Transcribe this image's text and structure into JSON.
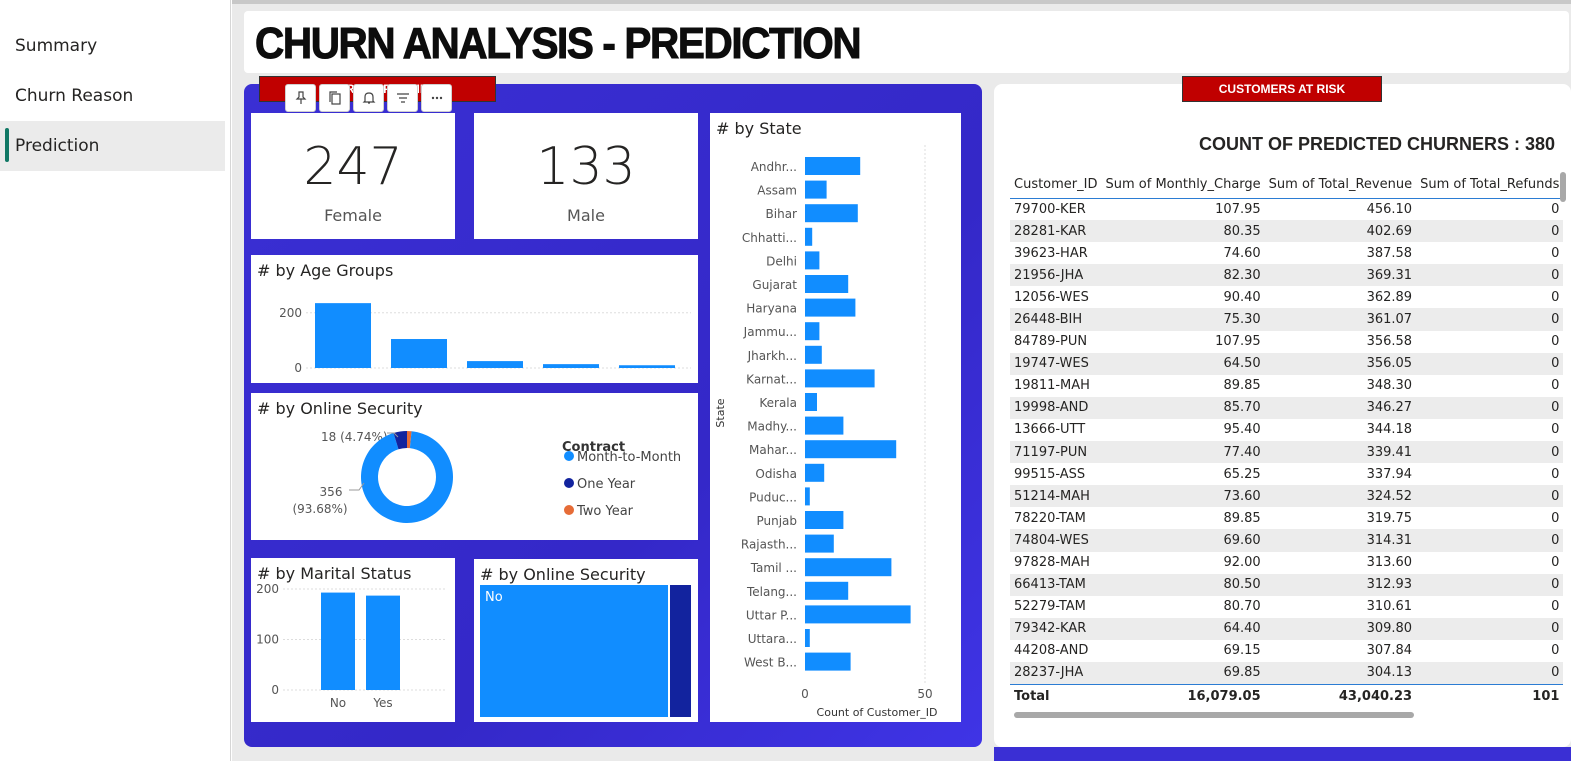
{
  "sidebar": {
    "items": [
      {
        "label": "Summary"
      },
      {
        "label": "Churn Reason"
      },
      {
        "label": "Prediction"
      }
    ]
  },
  "title": "CHURN ANALYSIS - PREDICTION",
  "left_banner": "CHURNED PROFILE",
  "right_banner": "CUSTOMERS AT RISK",
  "toolbar": {
    "icons": [
      "pin-icon",
      "copy-icon",
      "bell-icon",
      "filter-icon",
      "more-icon"
    ]
  },
  "kpis": {
    "female": {
      "value": "247",
      "label": "Female"
    },
    "male": {
      "value": "133",
      "label": "Male"
    }
  },
  "age_chart": {
    "title": "# by Age Groups"
  },
  "security_donut": {
    "title": "# by Online Security",
    "legend_title": "Contract",
    "label_small": "18 (4.74%)",
    "label_big_1": "356",
    "label_big_2": "(93.68%)"
  },
  "marital_chart": {
    "title": "# by Marital Status"
  },
  "security_treemap": {
    "title": "# by Online Security",
    "label": "No"
  },
  "state_chart": {
    "title": "# by State",
    "ylabel": "State",
    "xlabel": "Count of Customer_ID"
  },
  "colors": {
    "bar": "#118dff",
    "dark": "#12239e",
    "orange": "#e66c37",
    "panel": "#3a2fd4",
    "banner": "#c00000"
  },
  "chart_data": [
    {
      "type": "bar",
      "title": "# by Age Groups",
      "categories": [
        "",
        "",
        "",
        "",
        ""
      ],
      "values": [
        235,
        105,
        25,
        14,
        10
      ],
      "yticks": [
        "0",
        "200"
      ],
      "ylim": [
        0,
        250
      ]
    },
    {
      "type": "pie",
      "title": "# by Online Security",
      "series": [
        {
          "name": "Month-to-Month",
          "value": 356,
          "color": "#118dff"
        },
        {
          "name": "One Year",
          "value": 18,
          "color": "#12239e"
        },
        {
          "name": "Two Year",
          "value": 6,
          "color": "#e66c37"
        }
      ]
    },
    {
      "type": "bar",
      "title": "# by Marital Status",
      "categories": [
        "No",
        "Yes"
      ],
      "values": [
        193,
        187
      ],
      "yticks": [
        "0",
        "100",
        "200"
      ],
      "ylim": [
        0,
        210
      ]
    },
    {
      "type": "bar",
      "title": "# by State",
      "orientation": "horizontal",
      "categories": [
        "Andhr...",
        "Assam",
        "Bihar",
        "Chhatti...",
        "Delhi",
        "Gujarat",
        "Haryana",
        "Jammu...",
        "Jharkh...",
        "Karnat...",
        "Kerala",
        "Madhy...",
        "Mahar...",
        "Odisha",
        "Puduc...",
        "Punjab",
        "Rajasth...",
        "Tamil ...",
        "Telang...",
        "Uttar P...",
        "Uttara...",
        "West B..."
      ],
      "values": [
        23,
        9,
        22,
        3,
        6,
        18,
        21,
        6,
        7,
        29,
        5,
        16,
        38,
        8,
        2,
        16,
        12,
        36,
        18,
        44,
        2,
        19
      ],
      "xticks": [
        "0",
        "50"
      ],
      "xlim": [
        0,
        50
      ],
      "xlabel": "Count of Customer_ID",
      "ylabel": "State"
    },
    {
      "type": "table",
      "title": "COUNT OF PREDICTED CHURNERS : 380",
      "columns": [
        "Customer_ID",
        "Sum of Monthly_Charge",
        "Sum of Total_Revenue",
        "Sum of Total_Refunds"
      ],
      "rows": [
        [
          "79700-KER",
          "107.95",
          "456.10",
          "0"
        ],
        [
          "28281-KAR",
          "80.35",
          "402.69",
          "0"
        ],
        [
          "39623-HAR",
          "74.60",
          "387.58",
          "0"
        ],
        [
          "21956-JHA",
          "82.30",
          "369.31",
          "0"
        ],
        [
          "12056-WES",
          "90.40",
          "362.89",
          "0"
        ],
        [
          "26448-BIH",
          "75.30",
          "361.07",
          "0"
        ],
        [
          "84789-PUN",
          "107.95",
          "356.58",
          "0"
        ],
        [
          "19747-WES",
          "64.50",
          "356.05",
          "0"
        ],
        [
          "19811-MAH",
          "89.85",
          "348.30",
          "0"
        ],
        [
          "19998-AND",
          "85.70",
          "346.27",
          "0"
        ],
        [
          "13666-UTT",
          "95.40",
          "344.18",
          "0"
        ],
        [
          "71197-PUN",
          "77.40",
          "339.41",
          "0"
        ],
        [
          "99515-ASS",
          "65.25",
          "337.94",
          "0"
        ],
        [
          "51214-MAH",
          "73.60",
          "324.52",
          "0"
        ],
        [
          "78220-TAM",
          "89.85",
          "319.75",
          "0"
        ],
        [
          "74804-WES",
          "69.60",
          "314.31",
          "0"
        ],
        [
          "97828-MAH",
          "92.00",
          "313.60",
          "0"
        ],
        [
          "66413-TAM",
          "80.50",
          "312.93",
          "0"
        ],
        [
          "52279-TAM",
          "80.70",
          "310.61",
          "0"
        ],
        [
          "79342-KAR",
          "64.40",
          "309.80",
          "0"
        ],
        [
          "44208-AND",
          "69.15",
          "307.84",
          "0"
        ],
        [
          "28237-JHA",
          "69.85",
          "304.13",
          "0"
        ]
      ],
      "total": [
        "Total",
        "16,079.05",
        "43,040.23",
        "101"
      ]
    }
  ]
}
